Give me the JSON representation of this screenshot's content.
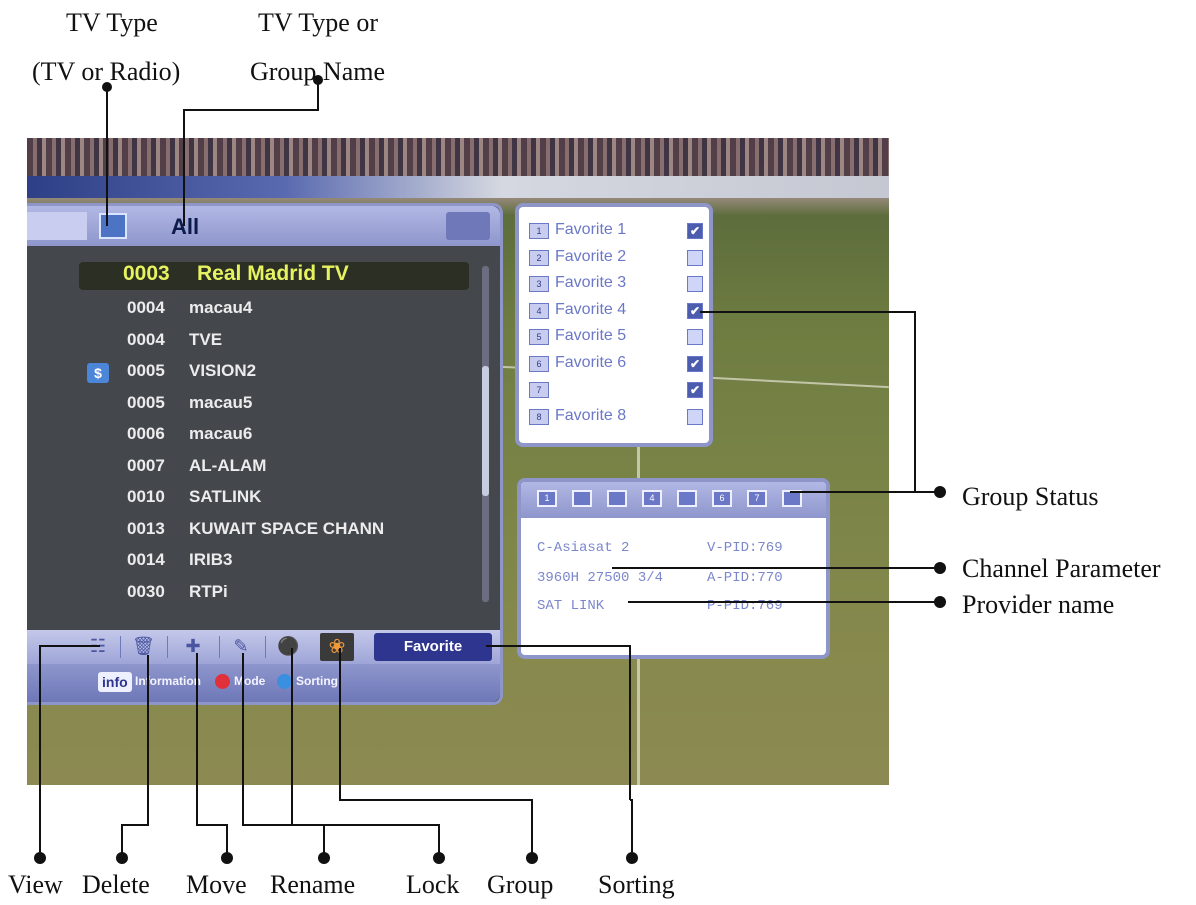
{
  "callouts": {
    "tv_type_line1": "TV Type",
    "tv_type_line2": "(TV or Radio)",
    "group_name_line1": "TV Type or",
    "group_name_line2": "Group Name",
    "group_status": "Group Status",
    "channel_parameter": "Channel Parameter",
    "provider_name": "Provider name",
    "view": "View",
    "delete": "Delete",
    "move": "Move",
    "rename": "Rename",
    "lock": "Lock",
    "group": "Group",
    "sorting": "Sorting"
  },
  "list_panel": {
    "title": "All",
    "selected": {
      "number": "0003",
      "name": "Real Madrid TV"
    },
    "channels": [
      {
        "number": "0004",
        "name": "macau4",
        "scrambled": false
      },
      {
        "number": "0004",
        "name": "TVE",
        "scrambled": false
      },
      {
        "number": "0005",
        "name": "VISION2",
        "scrambled": true
      },
      {
        "number": "0005",
        "name": "macau5",
        "scrambled": false
      },
      {
        "number": "0006",
        "name": "macau6",
        "scrambled": false
      },
      {
        "number": "0007",
        "name": "AL-ALAM",
        "scrambled": false
      },
      {
        "number": "0010",
        "name": "SATLINK",
        "scrambled": false
      },
      {
        "number": "0013",
        "name": "KUWAIT SPACE CHANN",
        "scrambled": false
      },
      {
        "number": "0014",
        "name": "IRIB3",
        "scrambled": false
      },
      {
        "number": "0030",
        "name": "RTPi",
        "scrambled": false
      }
    ],
    "paid_icon": "$",
    "favorite_button": "Favorite",
    "info_tag": "info",
    "info_text": "Information",
    "mode_text": "Mode",
    "sorting_text": "Sorting",
    "icons": [
      "view-icon",
      "delete-icon",
      "move-icon",
      "rename-icon",
      "lock-icon",
      "group-icon"
    ],
    "colors": {
      "mode_dot": "#e0303a",
      "sorting_dot": "#3a8fe0"
    }
  },
  "favorites": [
    {
      "num": "1",
      "label": "Favorite 1",
      "checked": true
    },
    {
      "num": "2",
      "label": "Favorite 2",
      "checked": false
    },
    {
      "num": "3",
      "label": "Favorite 3",
      "checked": false
    },
    {
      "num": "4",
      "label": "Favorite 4",
      "checked": true
    },
    {
      "num": "5",
      "label": "Favorite 5",
      "checked": false
    },
    {
      "num": "6",
      "label": "Favorite 6",
      "checked": true
    },
    {
      "num": "7",
      "label": "",
      "checked": true
    },
    {
      "num": "8",
      "label": "Favorite 8",
      "checked": false
    }
  ],
  "group_status": [
    "1",
    "",
    "",
    "4",
    "",
    "6",
    "7",
    ""
  ],
  "params": {
    "satellite": "C-Asiasat 2",
    "vpid": "V-PID:769",
    "tp": "3960H 27500 3/4",
    "apid": "A-PID:770",
    "provider": "SAT LINK",
    "ppid": "P-PID:769"
  }
}
